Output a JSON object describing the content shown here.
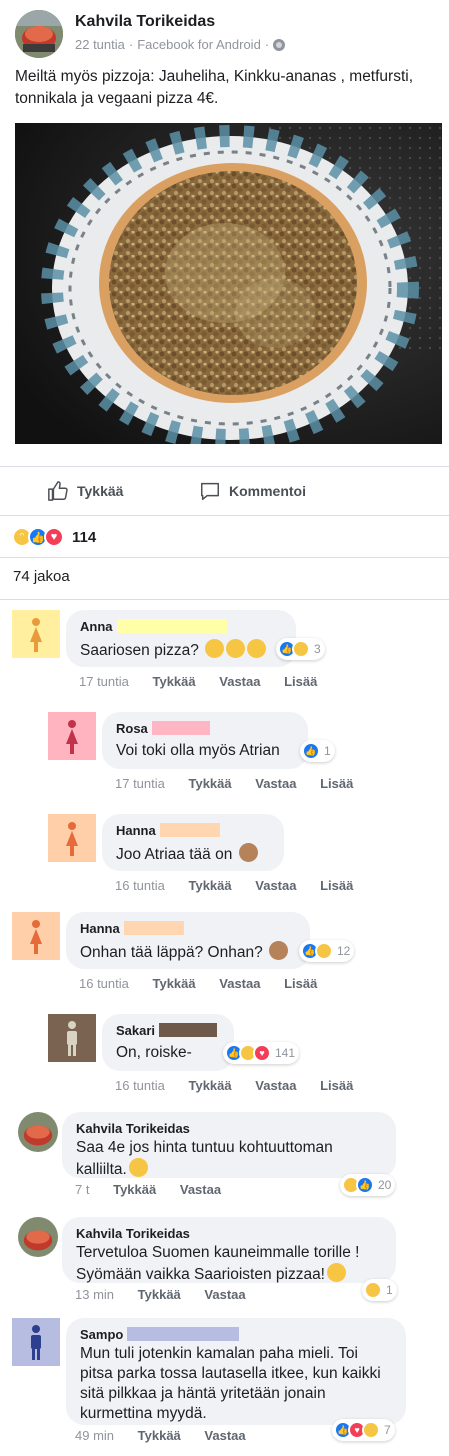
{
  "post": {
    "page_name": "Kahvila Torikeidas",
    "time": "22 tuntia",
    "source": "Facebook for Android",
    "dot": "·",
    "text": "Meiltä myös pizzoja: Jauheliha, Kinkku-ananas , metfursti, tonnikala ja vegaani pizza 4€."
  },
  "actions": {
    "like": "Tykkää",
    "comment": "Kommentoi"
  },
  "reactions": {
    "count": "114",
    "types": [
      "haha",
      "like",
      "love"
    ]
  },
  "shares": "74 jakoa",
  "comments": [
    {
      "name": "Anna",
      "text": "Saariosen pizza?",
      "time": "17 tuntia",
      "like": "Tykkää",
      "reply": "Vastaa",
      "more": "Lisää",
      "reaction_count": "3"
    },
    {
      "name": "Rosa",
      "text": "Voi toki olla myös Atrian",
      "time": "17 tuntia",
      "like": "Tykkää",
      "reply": "Vastaa",
      "more": "Lisää",
      "reaction_count": "1"
    },
    {
      "name": "Hanna",
      "text": "Joo Atriaa tää on",
      "time": "16 tuntia",
      "like": "Tykkää",
      "reply": "Vastaa",
      "more": "Lisää"
    },
    {
      "name": "Hanna",
      "text": "Onhan tää läppä? Onhan?",
      "time": "16 tuntia",
      "like": "Tykkää",
      "reply": "Vastaa",
      "more": "Lisää",
      "reaction_count": "12"
    },
    {
      "name": "Sakari",
      "text": "On, roiske-",
      "time": "16 tuntia",
      "like": "Tykkää",
      "reply": "Vastaa",
      "more": "Lisää",
      "reaction_count": "141"
    },
    {
      "name": "Kahvila Torikeidas",
      "text1": "Saa 4e jos hinta tuntuu kohtuuttoman",
      "text2": "kalliilta.",
      "time": "7 t",
      "like": "Tykkää",
      "reply": "Vastaa",
      "reaction_count": "20"
    },
    {
      "name": "Kahvila Torikeidas",
      "text1": "Tervetuloa Suomen kauneimmalle torille !",
      "text2": "Syömään vaikka Saarioisten pizzaa!",
      "time": "13 min",
      "like": "Tykkää",
      "reply": "Vastaa",
      "reaction_count": "1"
    },
    {
      "name": "Sampo",
      "text1": "Mun tuli jotenkin kamalan paha mieli. Toi",
      "text2": "pitsa parka tossa lautasella itkee, kun kaikki",
      "text3": "sitä pilkkaa ja häntä yritetään jonain",
      "text4": "kurmettina myydä.",
      "time": "49 min",
      "like": "Tykkää",
      "reply": "Vastaa",
      "reaction_count": "7"
    }
  ],
  "colors": {
    "like_blue": "#1877f2",
    "love_red": "#f33e58",
    "haha_yellow": "#f7c544",
    "bubble_bg": "#f0f2f5",
    "meta_gray": "#90949c"
  }
}
